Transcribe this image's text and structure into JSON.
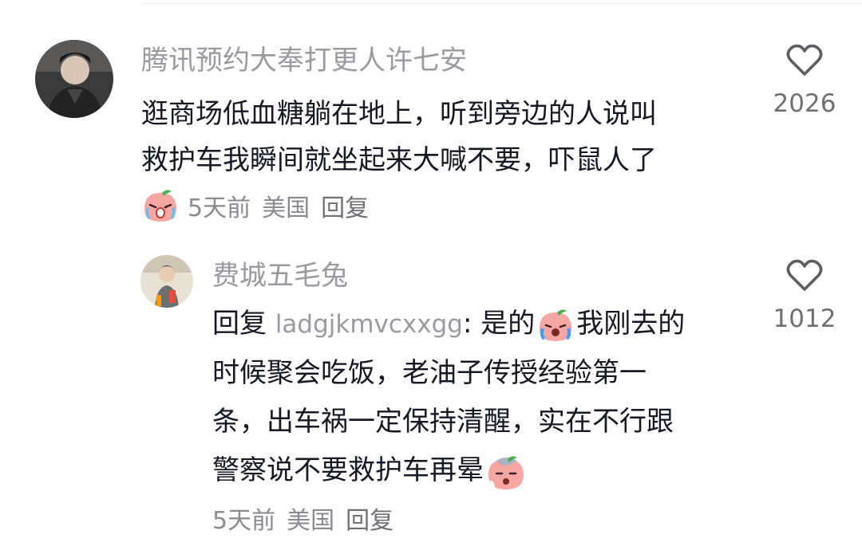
{
  "comments": [
    {
      "username": "腾讯预约大奉打更人许七安",
      "lines": [
        "逛商场低血糖躺在地上，听到旁边的人说叫",
        "救护车我瞬间就坐起来大喊不要，吓鼠人了"
      ],
      "time": "5天前",
      "location": "美国",
      "reply_label": "回复",
      "like_count": "2026",
      "reaction_icon": "crying-peach-emoji-icon"
    },
    {
      "username": "费城五毛兔",
      "reply_prefix": "回复",
      "reply_to": "ladgjkmvcxxgg",
      "line1_after_name": ": 是的",
      "line1_end": "我刚去的",
      "lines": [
        "时候聚会吃饭，老油子传授经验第一",
        "条，出车祸一定保持清醒，实在不行跟",
        "警察说不要救护车再晕"
      ],
      "time": "5天前",
      "location": "美国",
      "reply_label": "回复",
      "like_count": "1012",
      "inline_icons": [
        "crying-peach-emoji-icon",
        "dizzy-peach-emoji-icon"
      ]
    }
  ],
  "colors": {
    "username": "#9a9aa0",
    "text": "#161823",
    "meta": "#8a8a90",
    "heart": "#5d5d63",
    "peach": "#f6a7a3"
  }
}
